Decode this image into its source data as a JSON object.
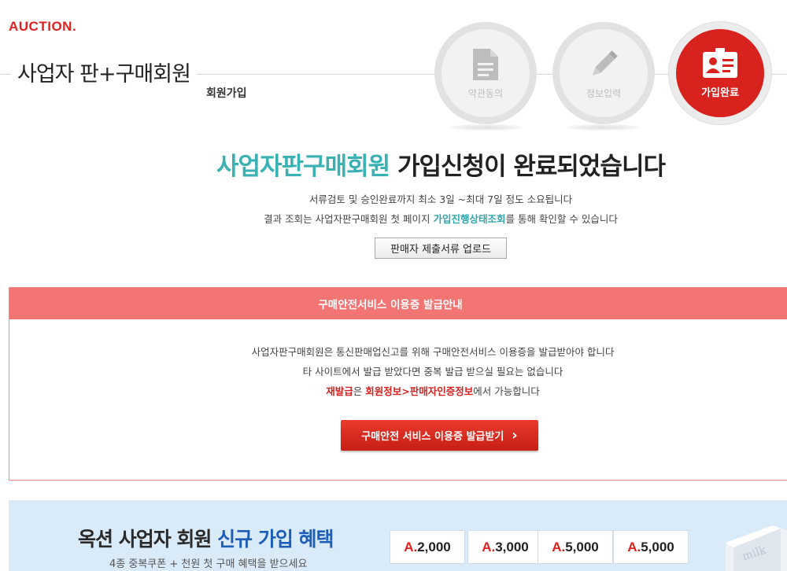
{
  "brand": {
    "logo": "AUCTION."
  },
  "page": {
    "title": "사업자 판+구매회원",
    "subtitle": "회원가입"
  },
  "steps": [
    {
      "label": "약관동의",
      "icon": "document-icon",
      "state": "done"
    },
    {
      "label": "정보입력",
      "icon": "pencil-icon",
      "state": "done"
    },
    {
      "label": "가입완료",
      "icon": "id-card-icon",
      "state": "active"
    }
  ],
  "completion": {
    "headline_highlight": "사업자판구매회원",
    "headline_rest": " 가입신청이 완료되었습니다",
    "info1": "서류검토 및 승인완료까지 최소 3일 ~최대 7일 정도 소요됩니다",
    "info2_before": "결과 조회는 사업자판구매회원 첫 페이지 ",
    "info2_link": "가입진행상태조회",
    "info2_after": "를 통해 확인할 수 있습니다",
    "upload_button": "판매자 제출서류 업로드"
  },
  "guide": {
    "header": "구매안전서비스 이용증 발급안내",
    "line1": "사업자판구매회원은 통신판매업신고를 위해 구매안전서비스 이용증을 발급받아야 합니다",
    "line2": "타 사이트에서 발급 받았다면 중복 발급 받으실 필요는 없습니다",
    "line3_reissue": "재발급",
    "line3_mid": "은 ",
    "line3_path": "회원정보>판매자인증정보",
    "line3_after": "에서 가능합니다",
    "button": "구매안전 서비스 이용증 발급받기",
    "button_arrow": "›"
  },
  "banner": {
    "title_before": "옥션 사업자 회원 ",
    "title_highlight": "신규 가입 혜택",
    "subtitle": "4종 중복쿠폰 + 천원 첫 구매 혜택을 받으세요",
    "coupons": [
      {
        "prefix": "A.",
        "amount": "2,000"
      },
      {
        "prefix": "A.",
        "amount": "3,000"
      },
      {
        "prefix": "A.",
        "amount": "5,000"
      },
      {
        "prefix": "A.",
        "amount": "5,000"
      }
    ],
    "product_label": "milk"
  },
  "colors": {
    "brand_red": "#e0201f",
    "teal": "#3ab1b3",
    "guide_pink": "#f27473",
    "banner_blue": "#d9eaf9"
  }
}
